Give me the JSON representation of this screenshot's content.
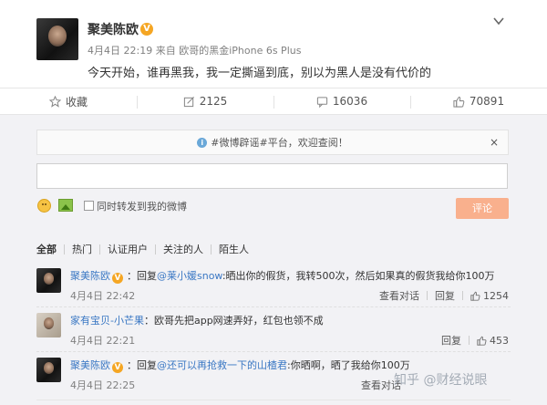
{
  "post": {
    "author": "聚美陈欧",
    "time": "4月4日 22:19",
    "source_prefix": "来自",
    "device": "欧哥的黑金iPhone 6s Plus",
    "text": "今天开始，谁再黑我，我一定撕逼到底，别以为黑人是没有代价的"
  },
  "actions": {
    "favorite_label": "收藏",
    "repost_count": "2125",
    "comment_count": "16036",
    "like_count": "70891"
  },
  "comment_box": {
    "notice": "#微博辟谣#平台，欢迎查阅！",
    "close": "×",
    "forward_label": "同时转发到我的微博",
    "submit_label": "评论"
  },
  "filters": [
    "全部",
    "热门",
    "认证用户",
    "关注的人",
    "陌生人"
  ],
  "comments": [
    {
      "nick": "聚美陈欧",
      "reply_prefix": "：回复",
      "mention": "@莱小媛snow",
      "text": ":晒出你的假货，我转500次，然后如果真的假货我给你100万",
      "time": "4月4日 22:42",
      "view_thread": "查看对话",
      "reply": "回复",
      "likes": "1254"
    },
    {
      "nick": "家有宝贝-小芒果",
      "reply_prefix": "：",
      "mention": "",
      "text": "欧哥先把app网速弄好，红包也领不成",
      "time": "4月4日 22:21",
      "view_thread": "",
      "reply": "回复",
      "likes": "453"
    },
    {
      "nick": "聚美陈欧",
      "reply_prefix": "：回复",
      "mention": "@还可以再抢救一下的山楂君",
      "text": ":你晒啊，晒了我给你100万",
      "time": "4月4日 22:25",
      "view_thread": "查看对话",
      "reply": "",
      "likes": ""
    }
  ],
  "watermark": "知乎 @财经说眼",
  "colors": {
    "link": "#3b78c4",
    "vip_badge": "#f5a623",
    "submit_button": "#f9b08d"
  },
  "icons": [
    "chevron-down-icon",
    "star-icon",
    "repost-icon",
    "comment-icon",
    "thumbs-up-icon",
    "info-icon",
    "emoji-icon",
    "image-icon"
  ]
}
